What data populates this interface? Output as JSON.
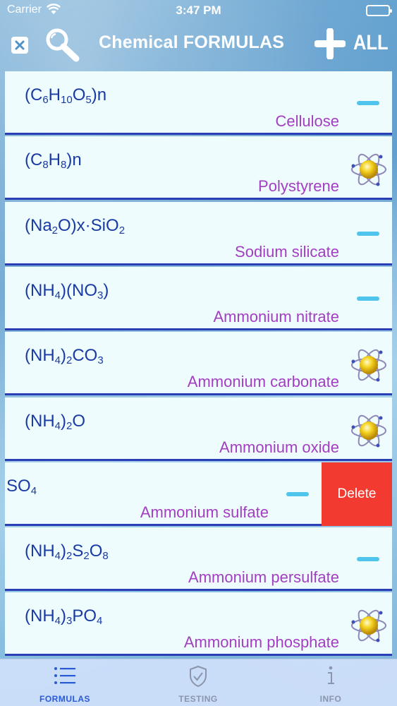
{
  "status_bar": {
    "carrier": "Carrier",
    "time": "3:47 PM"
  },
  "nav": {
    "title": "Chemical FORMULAS",
    "all_label": "ALL",
    "close_icon": "close-icon",
    "search_icon": "magnifier-icon",
    "add_icon": "plus-icon"
  },
  "rows": [
    {
      "formula_parts": [
        [
          "(C",
          ""
        ],
        [
          "6",
          "sub"
        ],
        [
          "H",
          ""
        ],
        [
          "10",
          "sub"
        ],
        [
          "O",
          ""
        ],
        [
          "5",
          "sub"
        ],
        [
          ")n",
          ""
        ]
      ],
      "name": "Cellulose",
      "marker": "dash"
    },
    {
      "formula_parts": [
        [
          "(C",
          ""
        ],
        [
          "8",
          "sub"
        ],
        [
          "H",
          ""
        ],
        [
          "8",
          "sub"
        ],
        [
          ")n",
          ""
        ]
      ],
      "name": "Polystyrene",
      "marker": "atom"
    },
    {
      "formula_parts": [
        [
          "(Na",
          ""
        ],
        [
          "2",
          "sub"
        ],
        [
          "O)x·SiO",
          ""
        ],
        [
          "2",
          "sub"
        ]
      ],
      "name": "Sodium silicate",
      "marker": "dash"
    },
    {
      "formula_parts": [
        [
          "(NH",
          ""
        ],
        [
          "4",
          "sub"
        ],
        [
          ")(NO",
          ""
        ],
        [
          "3",
          "sub"
        ],
        [
          ")",
          ""
        ]
      ],
      "name": "Ammonium nitrate",
      "marker": "dash"
    },
    {
      "formula_parts": [
        [
          "(NH",
          ""
        ],
        [
          "4",
          "sub"
        ],
        [
          ")",
          ""
        ],
        [
          "2",
          "sub"
        ],
        [
          "CO",
          ""
        ],
        [
          "3",
          "sub"
        ]
      ],
      "name": "Ammonium carbonate",
      "marker": "atom"
    },
    {
      "formula_parts": [
        [
          "(NH",
          ""
        ],
        [
          "4",
          "sub"
        ],
        [
          ")",
          ""
        ],
        [
          "2",
          "sub"
        ],
        [
          "O",
          ""
        ]
      ],
      "name": "Ammonium oxide",
      "marker": "atom"
    },
    {
      "formula_parts": [
        [
          "SO",
          ""
        ],
        [
          "4",
          "sub"
        ]
      ],
      "name": "Ammonium sulfate",
      "marker": "dash",
      "swiped": true,
      "delete_label": "Delete"
    },
    {
      "formula_parts": [
        [
          "(NH",
          ""
        ],
        [
          "4",
          "sub"
        ],
        [
          ")",
          ""
        ],
        [
          "2",
          "sub"
        ],
        [
          "S",
          ""
        ],
        [
          "2",
          "sub"
        ],
        [
          "O",
          ""
        ],
        [
          "8",
          "sub"
        ]
      ],
      "name": "Ammonium persulfate",
      "marker": "dash"
    },
    {
      "formula_parts": [
        [
          "(NH",
          ""
        ],
        [
          "4",
          "sub"
        ],
        [
          ")",
          ""
        ],
        [
          "3",
          "sub"
        ],
        [
          "PO",
          ""
        ],
        [
          "4",
          "sub"
        ]
      ],
      "name": "Ammonium phosphate",
      "marker": "atom"
    }
  ],
  "tabs": [
    {
      "label": "FORMULAS",
      "icon": "list-icon",
      "active": true
    },
    {
      "label": "TESTING",
      "icon": "shield-check-icon",
      "active": false
    },
    {
      "label": "INFO",
      "icon": "info-icon",
      "active": false
    }
  ],
  "colors": {
    "formula": "#1a3aa3",
    "name": "#a33ec2",
    "divider": "#2a3fb5",
    "dash": "#4fc4ec",
    "delete": "#f23a30",
    "tab_active": "#2a5bd7",
    "tab_inactive": "#8c95ab"
  }
}
